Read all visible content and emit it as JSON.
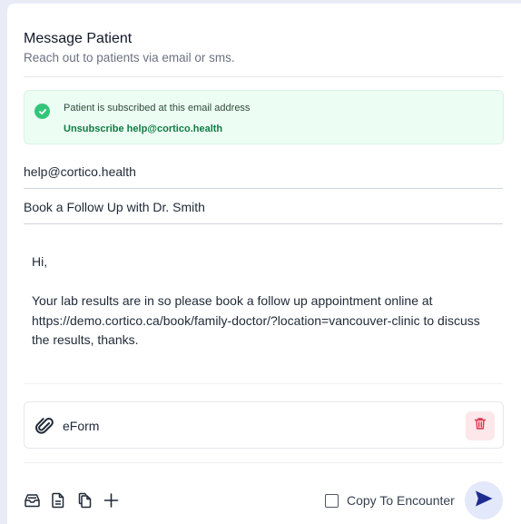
{
  "header": {
    "title": "Message Patient",
    "subtitle": "Reach out to patients via email or sms."
  },
  "alert": {
    "message": "Patient is subscribed at this email address",
    "unsubscribe_label": "Unsubscribe help@cortico.health",
    "icon": "check-circle-icon",
    "color": "#34c57a"
  },
  "form": {
    "email": "help@cortico.health",
    "subject": "Book a Follow Up with Dr. Smith",
    "body": "Hi,\n\nYour lab results are in so please book a follow up appointment online at https://demo.cortico.ca/book/family-doctor/?location=vancouver-clinic to discuss the results, thanks."
  },
  "attachment": {
    "name": "eForm",
    "icon": "paperclip-icon",
    "delete_icon": "trash-icon",
    "delete_color": "#e0344f"
  },
  "toolbar": {
    "icons": [
      "inbox-icon",
      "document-icon",
      "copy-icon",
      "plus-icon"
    ],
    "copy_to_encounter_label": "Copy To Encounter",
    "copy_to_encounter_checked": false,
    "send_icon": "send-icon",
    "send_color": "#1e2b8f"
  }
}
